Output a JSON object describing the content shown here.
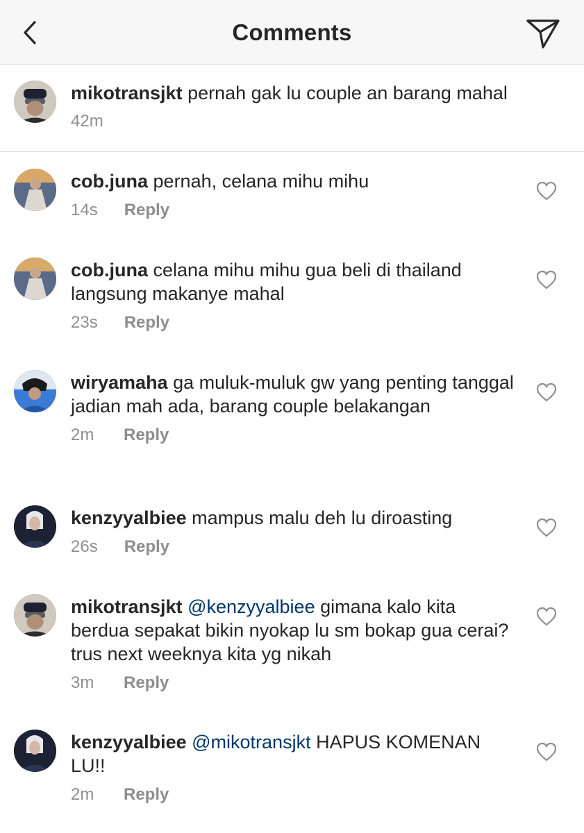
{
  "header": {
    "title": "Comments",
    "back_icon": "chevron-left-icon",
    "send_icon": "paper-plane-icon"
  },
  "caption": {
    "username": "mikotransjkt",
    "text": "pernah gak lu couple an barang mahal",
    "time": "42m"
  },
  "comments": [
    {
      "username": "cob.juna",
      "mention": "",
      "text": "pernah, celana mihu mihu",
      "time": "14s",
      "reply": "Reply"
    },
    {
      "username": "cob.juna",
      "mention": "",
      "text": "celana mihu mihu gua beli di thailand langsung makanye mahal",
      "time": "23s",
      "reply": "Reply"
    },
    {
      "username": "wiryamaha",
      "mention": "",
      "text": "ga muluk-muluk gw yang penting tanggal jadian mah ada, barang couple belakangan",
      "time": "2m",
      "reply": "Reply"
    },
    {
      "username": "kenzyyalbiee",
      "mention": "",
      "text": "mampus malu deh lu diroasting",
      "time": "26s",
      "reply": "Reply"
    },
    {
      "username": "mikotransjkt",
      "mention": "@kenzyyalbiee",
      "text": "gimana kalo kita berdua sepakat bikin nyokap lu sm bokap gua cerai? trus next weeknya kita yg nikah",
      "time": "3m",
      "reply": "Reply"
    },
    {
      "username": "kenzyyalbiee",
      "mention": "@mikotransjkt",
      "text": "HAPUS KOMENAN LU!!",
      "time": "2m",
      "reply": "Reply"
    }
  ],
  "colors": {
    "text": "#262626",
    "muted": "#8e8e8e",
    "mention": "#00376b",
    "divider": "#dbdbdb",
    "header_bg": "#f7f7f7"
  }
}
